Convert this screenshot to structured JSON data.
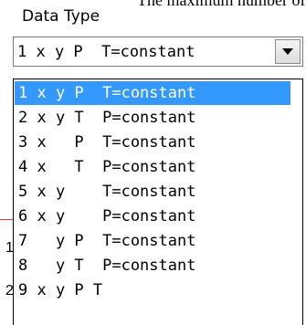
{
  "header_fragment": "The maximum number of poi",
  "label": "Data Type",
  "combo": {
    "value": "1 x y P  T=constant",
    "button": "dropdown-arrow"
  },
  "left_fragments": [
    "1",
    "2"
  ],
  "options": [
    "1 x y P  T=constant",
    "2 x y T  P=constant",
    "3 x   P  T=constant",
    "4 x   T  P=constant",
    "5 x y    T=constant",
    "6 x y    P=constant",
    "7   y P  T=constant",
    "8   y T  P=constant",
    "9 x y P T"
  ],
  "selected_index": 0,
  "colors": {
    "selection": "#3399ff",
    "selection_text": "#ffffff"
  }
}
